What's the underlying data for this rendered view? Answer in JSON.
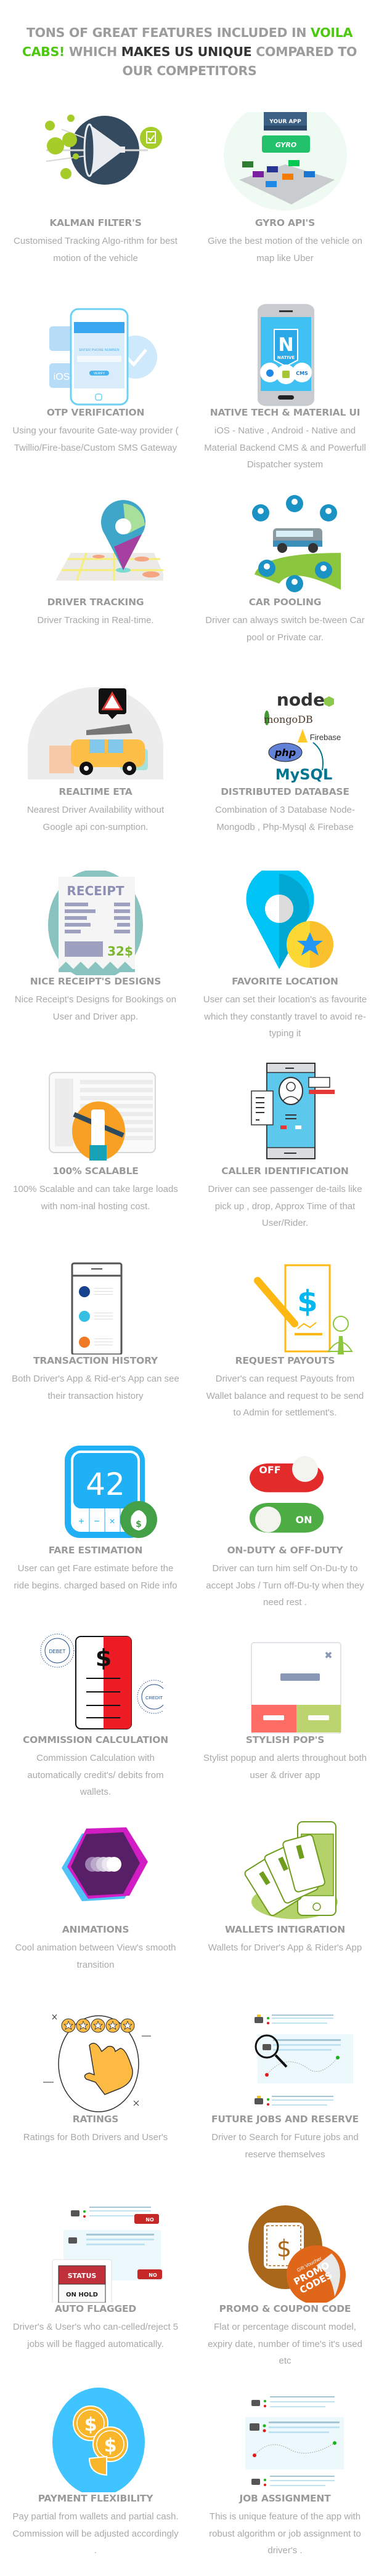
{
  "header": {
    "part1": "TONS OF GREAT FEATURES INCLUDED IN ",
    "brand": "VOILA CABS!",
    "part2": " WHICH ",
    "emphasis": "MAKES US UNIQUE",
    "part3": " COMPARED TO OUR COMPETITORS"
  },
  "colors": {
    "brand_green": "#4cc80e",
    "heading_gray": "#9c9c9c",
    "emphasis_dark": "#333333",
    "text_gray": "#a9a9a9"
  },
  "features": [
    {
      "icon": "kalman-filter-icon",
      "title": "KALMAN FILTER'S",
      "desc": "Customised Tracking Algo-rithm for best motion of the vehicle"
    },
    {
      "icon": "gyro-api-icon",
      "title": "GYRO API'S",
      "desc": "Give the best motion of the vehicle on map  like Uber"
    },
    {
      "icon": "otp-phone-icon",
      "title": "OTP VERIFICATION",
      "desc": "Using your favourite Gate-way provider ( Twillio/Fire-base/Custom SMS Gateway"
    },
    {
      "icon": "native-phone-icon",
      "title": "NATIVE TECH & MATERIAL UI",
      "desc": "iOS - Native , Android - Native and Material Backend CMS & and Powerfull Dispatcher system"
    },
    {
      "icon": "map-pin-icon",
      "title": "DRIVER TRACKING",
      "desc": "Driver Tracking in Real-time."
    },
    {
      "icon": "car-pool-icon",
      "title": "CAR POOLING",
      "desc": "Driver can always switch be-tween Car pool or Private car."
    },
    {
      "icon": "taxi-traffic-icon",
      "title": "REALTIME ETA",
      "desc": "Nearest Driver Availability without Google api con-sumption."
    },
    {
      "icon": "database-logos-icon",
      "title": "DISTRIBUTED DATABASE",
      "desc": "Combination of 3 Database Node-Mongodb , Php-Mysql & Firebase"
    },
    {
      "icon": "receipt-icon",
      "title": "NICE RECEIPT'S DESIGNS",
      "desc": "Nice Receipt's Designs for Bookings on User and Driver app."
    },
    {
      "icon": "favorite-location-icon",
      "title": "FAVORITE LOCATION",
      "desc": "User can set their location's as favourite which they constantly travel to avoid re-typing it"
    },
    {
      "icon": "wrench-hand-icon",
      "title": "100% SCALABLE",
      "desc": "100% Scalable and can take large loads with nom-inal hosting cost."
    },
    {
      "icon": "caller-id-icon",
      "title": "CALLER IDENTIFICATION",
      "desc": "Driver can see passenger de-tails like pick up , drop, Approx Time of that User/Rider."
    },
    {
      "icon": "transaction-list-icon",
      "title": "TRANSACTION HISTORY",
      "desc": "Both Driver's App & Rid-er's App can see their transaction history"
    },
    {
      "icon": "payout-pen-icon",
      "title": "REQUEST PAYOUTS",
      "desc": "Driver's can request Payouts from Wallet balance and request to be send to Admin for settlement's."
    },
    {
      "icon": "calculator-icon",
      "title": "FARE ESTIMATION",
      "desc": "User can get Fare estimate before the ride begins. charged based on Ride info"
    },
    {
      "icon": "on-off-toggle-icon",
      "title": "ON-DUTY & OFF-DUTY",
      "desc": "Driver can turn him self On-Du-ty to accept Jobs / Turn off-Du-ty when they need rest ."
    },
    {
      "icon": "commission-icon",
      "title": "COMMISSION CALCULATION",
      "desc": "Commission Calculation with automatically credit's/ debits from wallets."
    },
    {
      "icon": "popup-icon",
      "title": "STYLISH POP'S",
      "desc": "Stylist popup and alerts throughout both user & driver app"
    },
    {
      "icon": "animation-hexagon-icon",
      "title": "ANIMATIONS",
      "desc": "Cool animation between View's smooth transition"
    },
    {
      "icon": "wallet-cards-icon",
      "title": "WALLETS INTIGRATION",
      "desc": "Wallets for Driver's App & Rider's App"
    },
    {
      "icon": "rating-stars-icon",
      "title": "RATINGS",
      "desc": "Ratings for Both Drivers and User's"
    },
    {
      "icon": "job-search-icon",
      "title": "FUTURE JOBS AND RESERVE",
      "desc": "Driver to Search for Future jobs and reserve themselves"
    },
    {
      "icon": "status-hold-icon",
      "title": "AUTO FLAGGED",
      "desc": "Driver's & User's who can-celled/reject 5 jobs will be flagged automatically."
    },
    {
      "icon": "promo-code-icon",
      "title": "PROMO & COUPON CODE",
      "desc": "Flat or percentage discount model, expiry date, number of time's it's used etc"
    },
    {
      "icon": "coins-icon",
      "title": "PAYMENT FLEXIBILITY",
      "desc": "Pay partial from wallets and partial cash. Commission will be adjusted accordingly ."
    },
    {
      "icon": "job-assignment-icon",
      "title": "JOB ASSIGNMENT",
      "desc": "This is unique feature of the app with robust algorithm or job assignment to driver's ."
    }
  ],
  "illustration_text": {
    "gyro_app": "YOUR APP",
    "gyro": "GYRO",
    "otp_prompt": "ENTER PHONE NUMBER",
    "otp_button": "VERIFY",
    "otp_ios": "iOS",
    "native_badge": "NATIVE",
    "native_cms": "CMS",
    "db_node": "node",
    "db_mongo": "mongoDB",
    "db_firebase": "Firebase",
    "db_php": "php",
    "db_mysql": "MySQL",
    "receipt_title": "RECEIPT",
    "receipt_amount": "32$",
    "calc_value": "42",
    "toggle_off": "OFF",
    "toggle_on": "ON",
    "debit": "DEBET",
    "credit": "CREDIT",
    "status_label": "STATUS",
    "status_value": "ON HOLD",
    "no_label": "NO",
    "promo_gift": "Gift Voucher",
    "promo_text": "PROMO",
    "promo_codes": "CODES"
  }
}
